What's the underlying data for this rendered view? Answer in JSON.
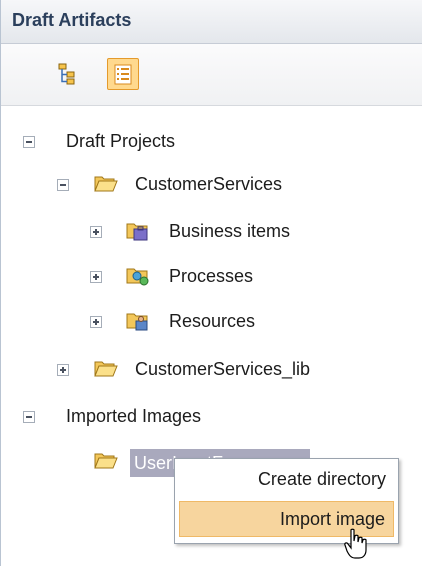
{
  "panel": {
    "title": "Draft Artifacts"
  },
  "toolbar": {
    "buttons": [
      {
        "icon": "hierarchy-view-icon",
        "active": false
      },
      {
        "icon": "list-view-icon",
        "active": true
      }
    ]
  },
  "tree": {
    "draft_projects": "Draft Projects",
    "customer_services": "CustomerServices",
    "business_items": "Business items",
    "processes": "Processes",
    "resources": "Resources",
    "customer_services_lib": "CustomerServices_lib",
    "imported_images": "Imported Images",
    "user_input_forms": "UserInputForms"
  },
  "context_menu": {
    "items": [
      "Create directory",
      "Import image"
    ],
    "highlighted": "Import image"
  },
  "colors": {
    "title_text": "#2b3f5c",
    "selection": "#a9a9bd",
    "menu_highlight": "#f7d59e",
    "folder": "#f3c75a"
  }
}
